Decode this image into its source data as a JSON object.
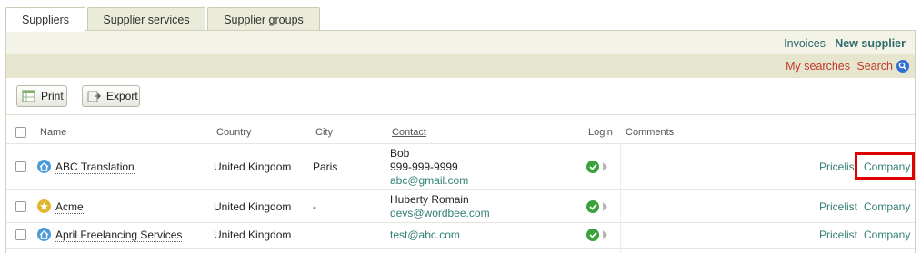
{
  "tabs": [
    {
      "label": "Suppliers",
      "active": true
    },
    {
      "label": "Supplier services",
      "active": false
    },
    {
      "label": "Supplier groups",
      "active": false
    }
  ],
  "toolbar": {
    "invoices": "Invoices",
    "new_supplier": "New supplier",
    "my_searches": "My searches",
    "search": "Search",
    "print": "Print",
    "export": "Export"
  },
  "columns": {
    "name": "Name",
    "country": "Country",
    "city": "City",
    "contact": "Contact",
    "login": "Login",
    "comments": "Comments"
  },
  "rows": [
    {
      "icon": "home-icon",
      "name": "ABC Translation",
      "country": "United Kingdom",
      "city": "Paris",
      "contact_name": "Bob",
      "contact_phone": "999-999-9999",
      "contact_email": "abc@gmail.com",
      "pricelist": "Pricelist",
      "company": "Company"
    },
    {
      "icon": "star-icon",
      "name": "Acme",
      "country": "United Kingdom",
      "city": "-",
      "contact_name": "Huberty Romain",
      "contact_email": "devs@wordbee.com",
      "pricelist": "Pricelist",
      "company": "Company"
    },
    {
      "icon": "home-icon",
      "name": "April Freelancing Services",
      "country": "United Kingdom",
      "city": "",
      "contact_email": "test@abc.com",
      "pricelist": "Pricelist",
      "company": "Company"
    }
  ],
  "colors": {
    "accent_link": "#2f6b6b",
    "search_link": "#c0392b",
    "highlight": "#e00000",
    "status_ok": "#3aa23a"
  }
}
